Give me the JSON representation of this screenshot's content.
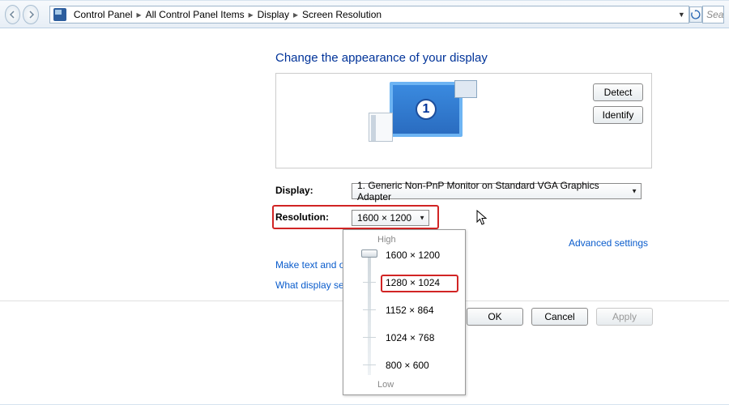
{
  "breadcrumb": {
    "items": [
      "Control Panel",
      "All Control Panel Items",
      "Display",
      "Screen Resolution"
    ]
  },
  "search": {
    "placeholder": "Sea"
  },
  "heading": "Change the appearance of your display",
  "preview": {
    "monitor_number": "1",
    "detect_label": "Detect",
    "identify_label": "Identify"
  },
  "fields": {
    "display_label": "Display:",
    "display_value": "1. Generic Non-PnP Monitor on Standard VGA Graphics Adapter",
    "resolution_label": "Resolution:",
    "resolution_value": "1600 × 1200"
  },
  "links": {
    "advanced": "Advanced settings",
    "text_size": "Make text and other",
    "what_display": "What display setting"
  },
  "resolution_popup": {
    "high_label": "High",
    "low_label": "Low",
    "options": [
      "1600 × 1200",
      "1280 × 1024",
      "1152 × 864",
      "1024 × 768",
      "800 × 600"
    ]
  },
  "buttons": {
    "ok": "OK",
    "cancel": "Cancel",
    "apply": "Apply"
  }
}
